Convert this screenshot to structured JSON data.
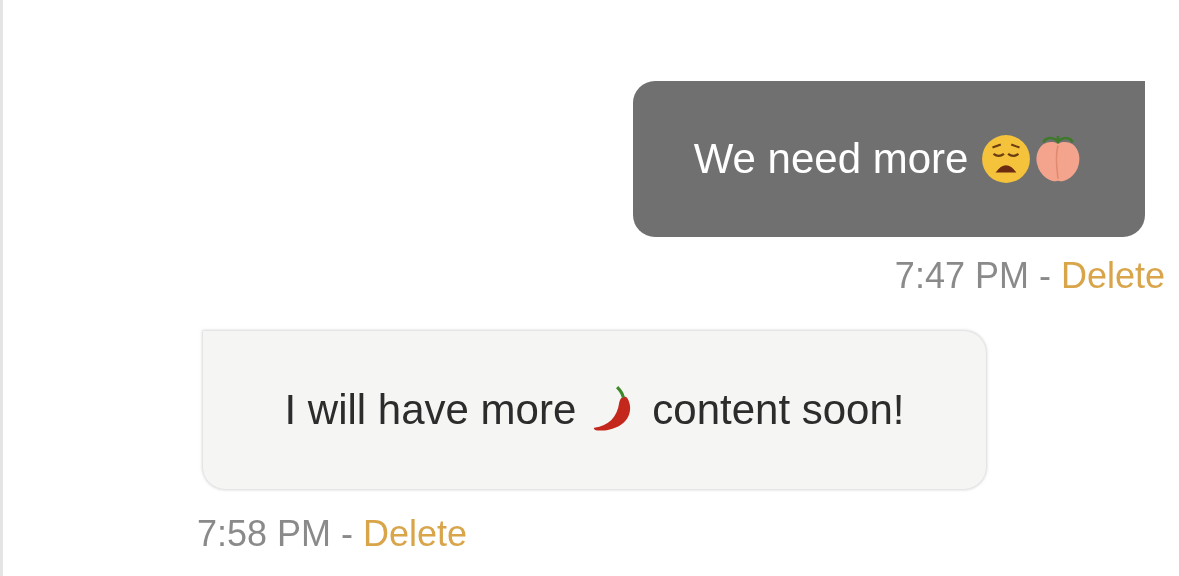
{
  "messages": [
    {
      "kind": "sent",
      "parts": [
        {
          "kind": "text",
          "text": "We need more"
        },
        {
          "kind": "weary_face"
        },
        {
          "kind": "peach"
        }
      ],
      "time": "7:47 PM",
      "separator": "-",
      "action": "Delete"
    },
    {
      "kind": "received",
      "parts": [
        {
          "kind": "text",
          "text": "I will have more"
        },
        {
          "kind": "chili"
        },
        {
          "kind": "text",
          "text": "content soon!"
        }
      ],
      "time": "7:58 PM",
      "separator": "-",
      "action": "Delete"
    }
  ]
}
